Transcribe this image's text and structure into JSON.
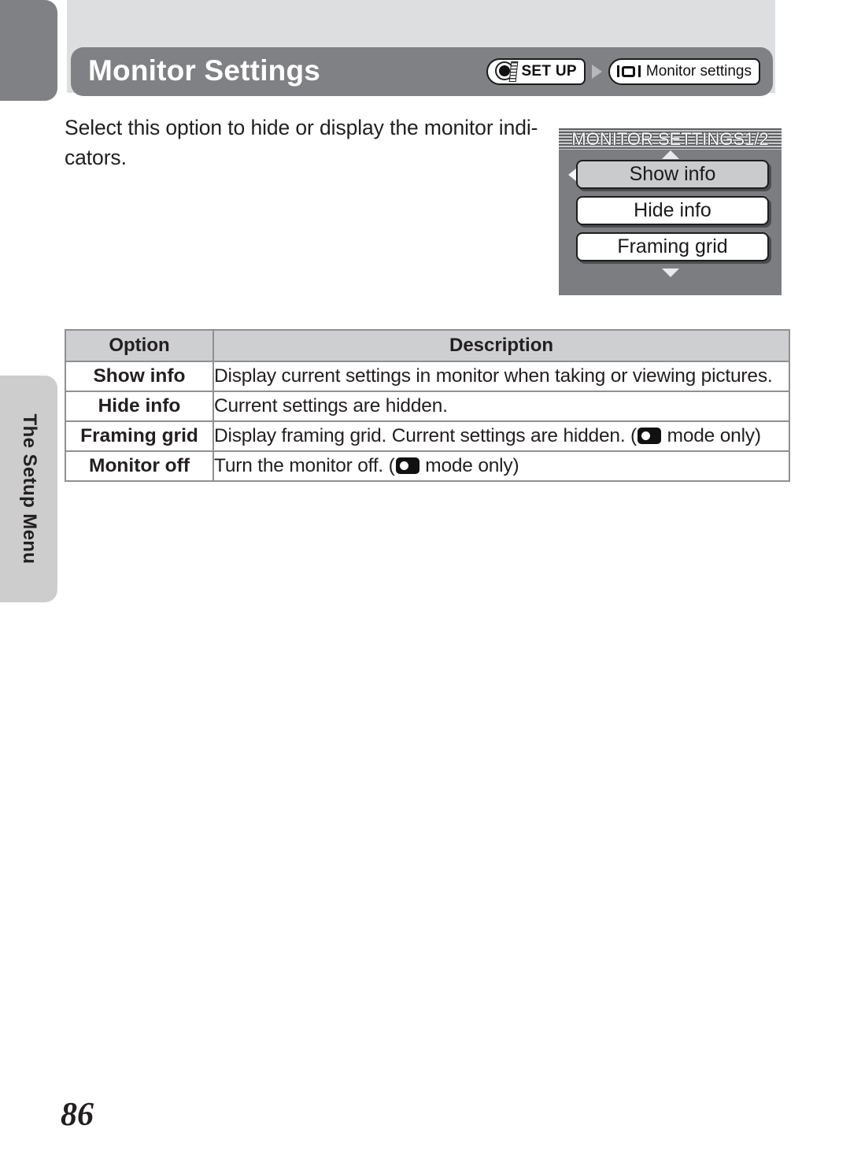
{
  "page": {
    "number": "86",
    "chapter_tab": "The Setup Menu"
  },
  "header": {
    "title": "Monitor Settings",
    "breadcrumb": [
      {
        "icon": "mode-dial-icon",
        "label": "SET UP"
      },
      {
        "icon": "monitor-icon",
        "label": "Monitor settings"
      }
    ],
    "separator_icon": "chevron-right-icon",
    "bar_color": "#808184",
    "band_color": "#dcdee0"
  },
  "body": {
    "paragraph": "Select this option to hide or display the monitor indi-cators."
  },
  "lcd": {
    "title": "MONITOR SETTINGS1/2",
    "scroll_up_icon": "triangle-up-icon",
    "scroll_down_icon": "triangle-down-icon",
    "cursor_icon": "triangle-left-icon",
    "options": [
      {
        "label": "Show info",
        "selected": true
      },
      {
        "label": "Hide info",
        "selected": false
      },
      {
        "label": "Framing grid",
        "selected": false
      }
    ],
    "background_color": "#7b7d80",
    "selected_fill": "#c9cbcd"
  },
  "table": {
    "headers": [
      "Option",
      "Description"
    ],
    "header_fill": "#cdcfd1",
    "border_color": "#8e9093",
    "rows": [
      {
        "option": "Show info",
        "description_before": "Display current settings in monitor when taking or viewing pictures.",
        "has_icon": false,
        "description_after": ""
      },
      {
        "option": "Hide info",
        "description_before": "Current settings are hidden.",
        "has_icon": false,
        "description_after": ""
      },
      {
        "option": "Framing grid",
        "description_before": "Display framing grid. Current settings are hidden. (",
        "has_icon": true,
        "icon": "camera-mode-icon",
        "description_after": " mode only)"
      },
      {
        "option": "Monitor off",
        "description_before": "Turn the monitor off. (",
        "has_icon": true,
        "icon": "camera-mode-icon",
        "description_after": " mode only)"
      }
    ]
  }
}
